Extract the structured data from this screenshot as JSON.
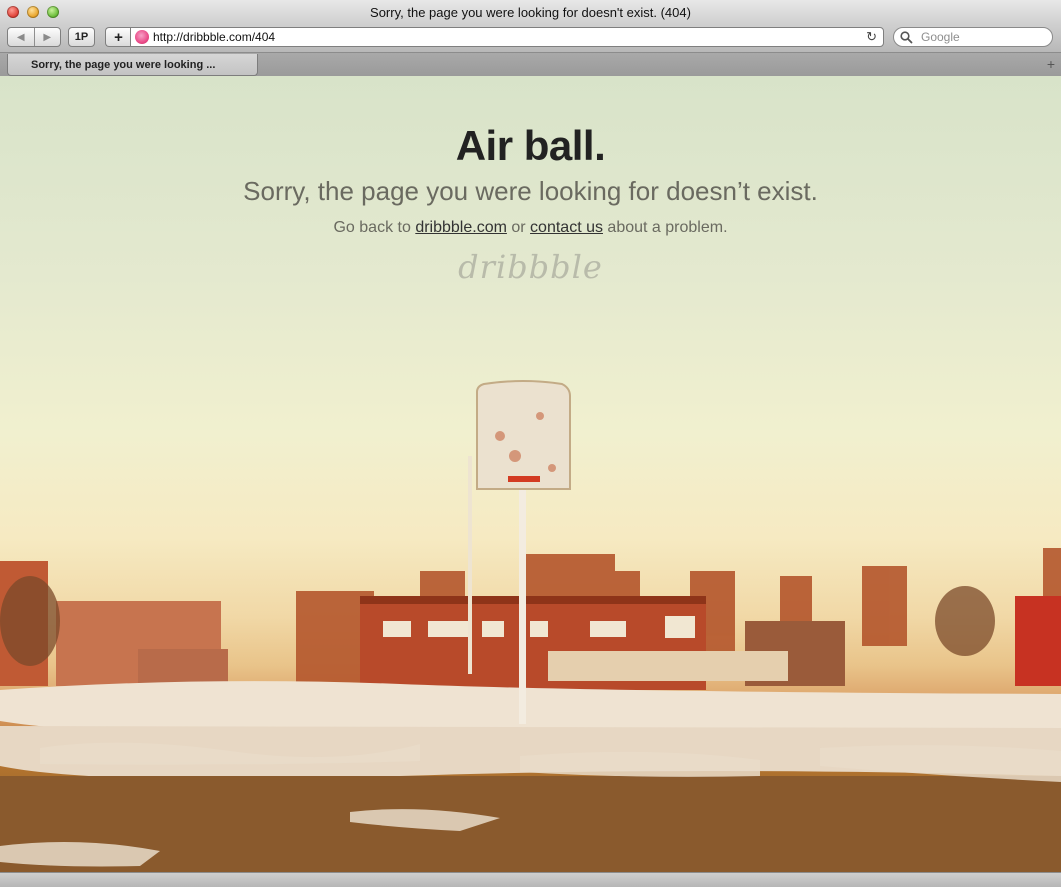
{
  "window": {
    "title": "Sorry, the page you were looking for doesn't exist. (404)"
  },
  "toolbar": {
    "onepassword_label": "1P",
    "add_label": "+",
    "url": "http://dribbble.com/404",
    "search_placeholder": "Google"
  },
  "tabs": [
    {
      "label": "Sorry, the page you were looking ..."
    }
  ],
  "page": {
    "headline": "Air ball.",
    "message": "Sorry, the page you were looking for doesn’t exist.",
    "help_prefix": "Go back to ",
    "home_link": "dribbble.com",
    "help_middle": " or ",
    "contact_link": "contact us",
    "help_suffix": " about a problem.",
    "logo_text": "dribbble"
  },
  "colors": {
    "favicon": "#ea4c89",
    "headline": "#222222",
    "message": "#6a6a60"
  }
}
